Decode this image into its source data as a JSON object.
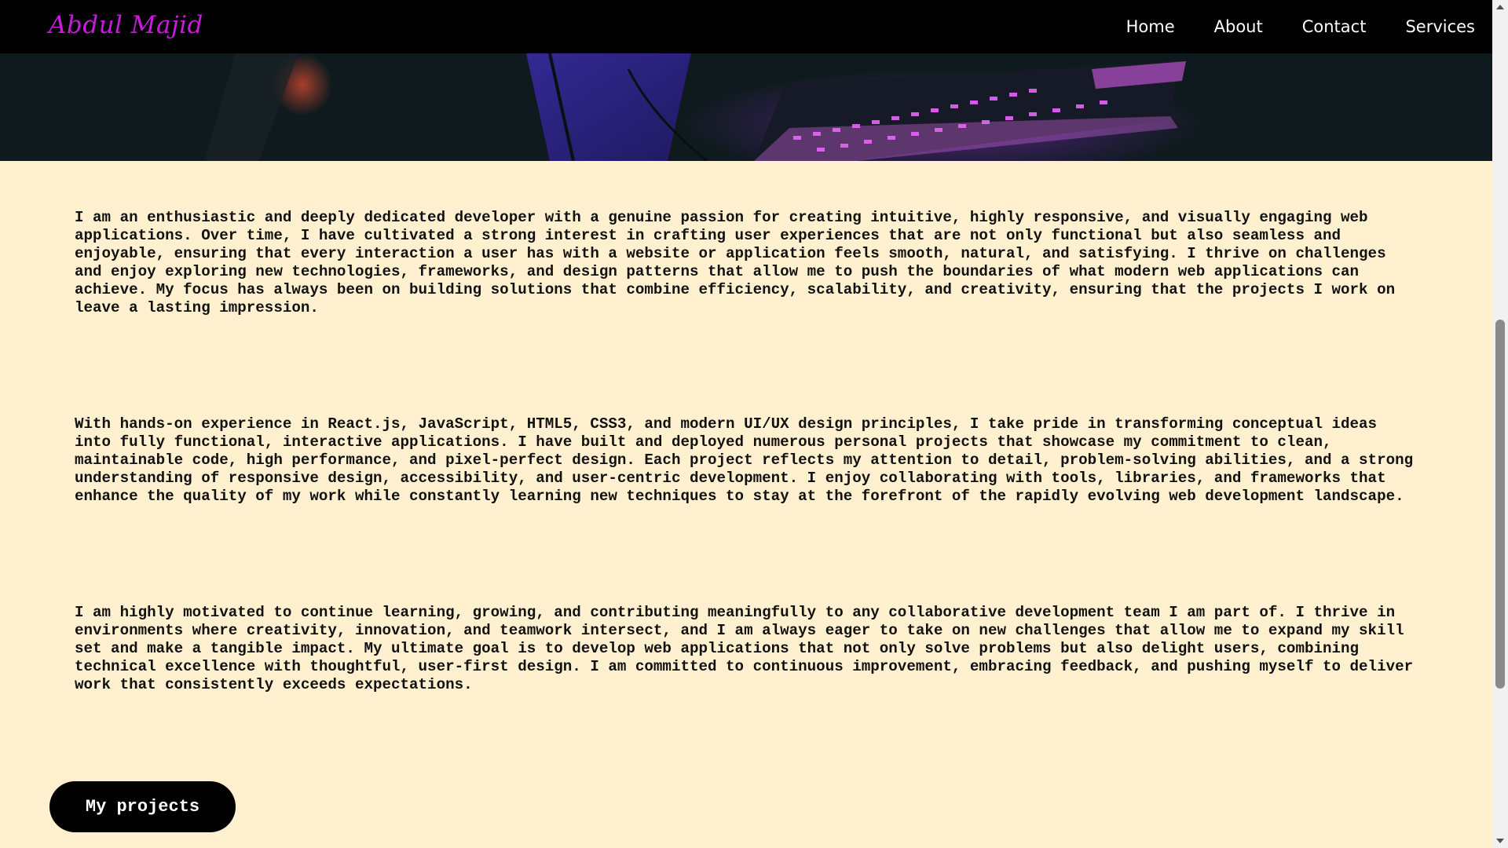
{
  "header": {
    "brand": "Abdul Majid",
    "nav": [
      {
        "label": "Home"
      },
      {
        "label": "About"
      },
      {
        "label": "Contact"
      },
      {
        "label": "Services"
      }
    ]
  },
  "hero": {
    "image_icon": "keyboard-image"
  },
  "about": {
    "paragraphs": [
      "I am an enthusiastic and deeply dedicated developer with a genuine passion for creating intuitive, highly responsive, and visually engaging web applications. Over time, I have cultivated a strong interest in crafting user experiences that are not only functional but also seamless and enjoyable, ensuring that every interaction a user has with a website or application feels smooth, natural, and satisfying. I thrive on challenges and enjoy exploring new technologies, frameworks, and design patterns that allow me to push the boundaries of what modern web applications can achieve. My focus has always been on building solutions that combine efficiency, scalability, and creativity, ensuring that the projects I work on leave a lasting impression.",
      "With hands-on experience in React.js, JavaScript, HTML5, CSS3, and modern UI/UX design principles, I take pride in transforming conceptual ideas into fully functional, interactive applications. I have built and deployed numerous personal projects that showcase my commitment to clean, maintainable code, high performance, and pixel-perfect design. Each project reflects my attention to detail, problem-solving abilities, and a strong understanding of responsive design, accessibility, and user-centric development. I enjoy collaborating with tools, libraries, and frameworks that enhance the quality of my work while constantly learning new techniques to stay at the forefront of the rapidly evolving web development landscape.",
      "I am highly motivated to continue learning, growing, and contributing meaningfully to any collaborative development team I am part of. I thrive in environments where creativity, innovation, and teamwork intersect, and I am always eager to take on new challenges that allow me to expand my skill set and make a tangible impact. My ultimate goal is to develop web applications that not only solve problems but also delight users, combining technical excellence with thoughtful, user-first design. I am committed to continuous improvement, embracing feedback, and pushing myself to deliver work that consistently exceeds expectations."
    ],
    "projects_button": "My projects"
  },
  "colors": {
    "brand": "#c81bdc",
    "navbar_bg": "#000000",
    "page_bg": "#fff1cf",
    "button_bg": "#000000"
  }
}
